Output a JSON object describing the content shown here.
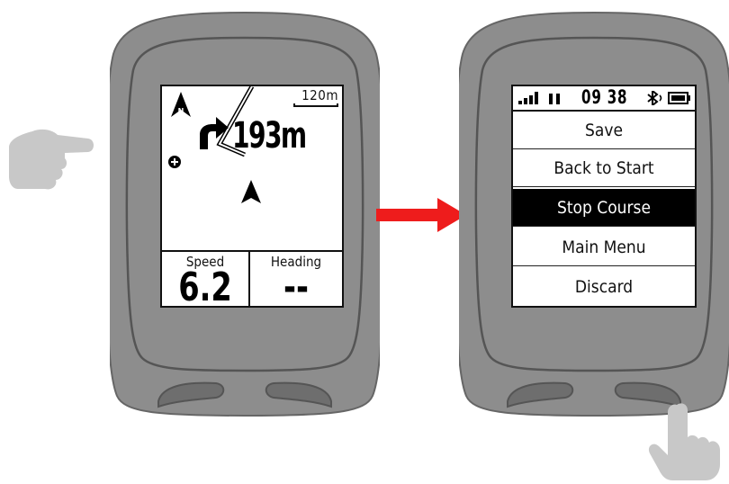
{
  "map_screen": {
    "scale_label": "120m",
    "turn_distance": "193m",
    "fields": [
      {
        "label": "Speed",
        "value": "6.2"
      },
      {
        "label": "Heading",
        "value": "--"
      }
    ]
  },
  "menu_screen": {
    "clock": "09 38",
    "items": [
      {
        "label": "Save",
        "selected": false
      },
      {
        "label": "Back to Start",
        "selected": false
      },
      {
        "label": "Stop Course",
        "selected": true
      },
      {
        "label": "Main Menu",
        "selected": false
      },
      {
        "label": "Discard",
        "selected": false
      }
    ]
  },
  "colors": {
    "shell": "#8d8d8d",
    "shell_dark": "#6b6b6b",
    "arrow": "#ee1c1c",
    "hand": "#c8c8c8"
  },
  "icons": [
    "north-arrow-icon",
    "turn-right-icon",
    "position-arrow-icon",
    "waypoint-icon",
    "signal-icon",
    "bluetooth-icon",
    "battery-icon",
    "pointing-hand-icon",
    "pressing-hand-icon",
    "right-arrow-icon"
  ]
}
